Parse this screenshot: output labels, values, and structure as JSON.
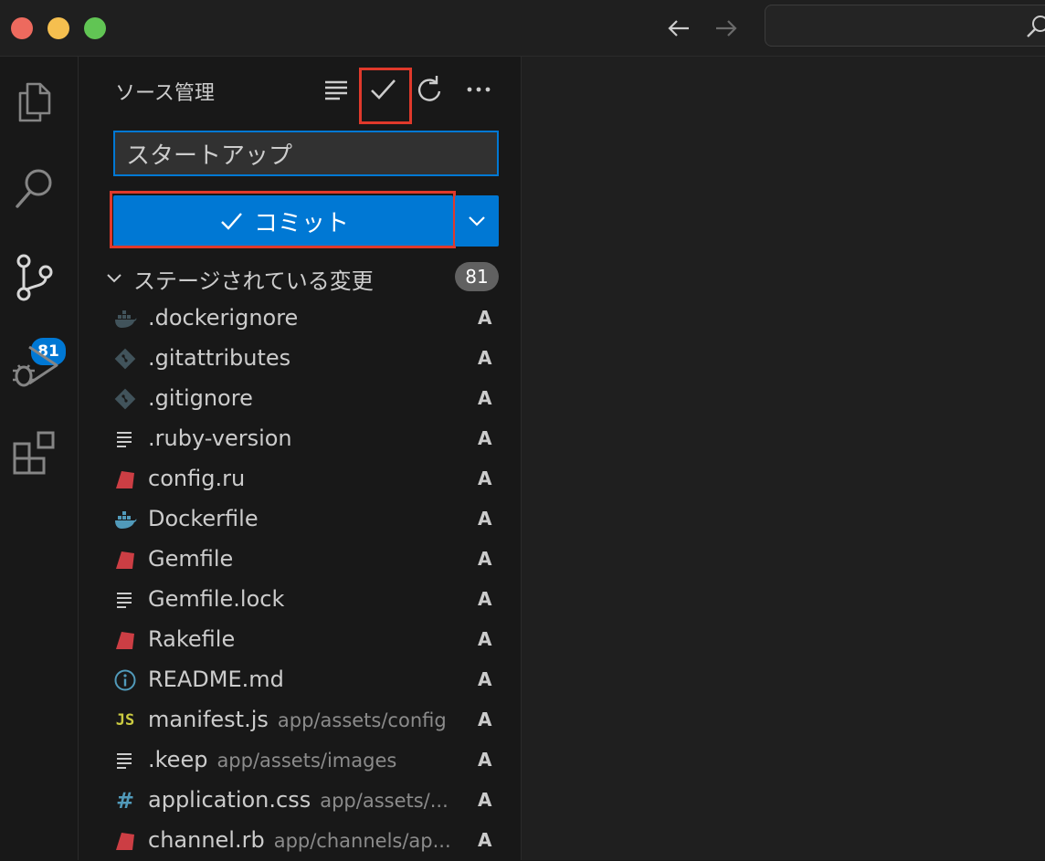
{
  "sidebar": {
    "title": "ソース管理",
    "commit_message": "スタートアップ",
    "commit_label": "コミット",
    "section_title": "ステージされている変更",
    "section_count": "81"
  },
  "activity": {
    "scm_badge": "81"
  },
  "files": [
    {
      "name": ".dockerignore",
      "path": "",
      "status": "A",
      "icon": "docker-icon"
    },
    {
      "name": ".gitattributes",
      "path": "",
      "status": "A",
      "icon": "git-icon"
    },
    {
      "name": ".gitignore",
      "path": "",
      "status": "A",
      "icon": "git-icon"
    },
    {
      "name": ".ruby-version",
      "path": "",
      "status": "A",
      "icon": "text-file-icon"
    },
    {
      "name": "config.ru",
      "path": "",
      "status": "A",
      "icon": "ruby-icon"
    },
    {
      "name": "Dockerfile",
      "path": "",
      "status": "A",
      "icon": "docker-icon"
    },
    {
      "name": "Gemfile",
      "path": "",
      "status": "A",
      "icon": "ruby-icon"
    },
    {
      "name": "Gemfile.lock",
      "path": "",
      "status": "A",
      "icon": "text-file-icon"
    },
    {
      "name": "Rakefile",
      "path": "",
      "status": "A",
      "icon": "ruby-icon"
    },
    {
      "name": "README.md",
      "path": "",
      "status": "A",
      "icon": "info-icon"
    },
    {
      "name": "manifest.js",
      "path": "app/assets/config",
      "status": "A",
      "icon": "js-icon"
    },
    {
      "name": ".keep",
      "path": "app/assets/images",
      "status": "A",
      "icon": "text-file-icon"
    },
    {
      "name": "application.css",
      "path": "app/assets/...",
      "status": "A",
      "icon": "css-icon"
    },
    {
      "name": "channel.rb",
      "path": "app/channels/ap...",
      "status": "A",
      "icon": "ruby-icon"
    }
  ],
  "colors": {
    "accent": "#0078d4",
    "highlight": "#e0392b",
    "ruby": "#cc3e44",
    "docker": "#519aba",
    "js": "#cbcb41"
  }
}
